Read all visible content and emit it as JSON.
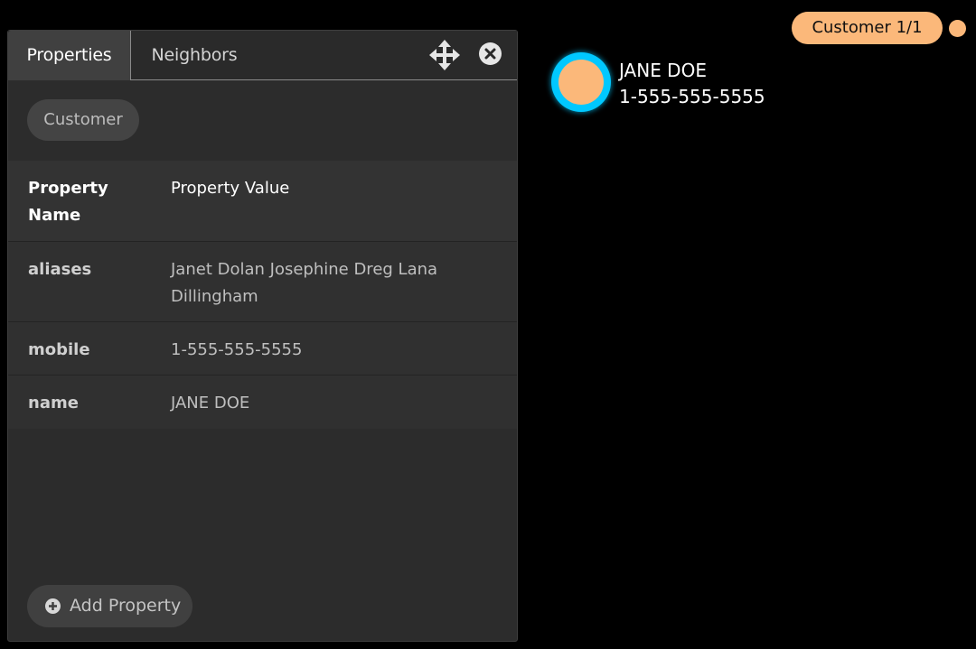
{
  "panel": {
    "tabs": [
      {
        "label": "Properties",
        "active": true
      },
      {
        "label": "Neighbors",
        "active": false
      }
    ],
    "icons": {
      "move": "move-arrows-icon",
      "close": "close-circle-icon"
    },
    "label_chip": "Customer",
    "table": {
      "headers": {
        "name": "Property Name",
        "value": "Property Value"
      },
      "rows": [
        {
          "name": "aliases",
          "value": "Janet Dolan Josephine Dreg Lana Dillingham"
        },
        {
          "name": "mobile",
          "value": "1-555-555-5555"
        },
        {
          "name": "name",
          "value": "JANE DOE"
        }
      ]
    },
    "add_button": {
      "label": "Add Property",
      "icon": "plus-circle-icon"
    }
  },
  "graph": {
    "legend": {
      "label": "Customer 1/1",
      "color": "#fbb87a"
    },
    "node": {
      "title": "JANE DOE",
      "subtitle": "1-555-555-5555",
      "fill_color": "#fbb87a",
      "highlight_color": "#00c8ff"
    }
  },
  "colors": {
    "background": "#000000",
    "panel": "#2c2c2c",
    "accent": "#fbb87a"
  }
}
